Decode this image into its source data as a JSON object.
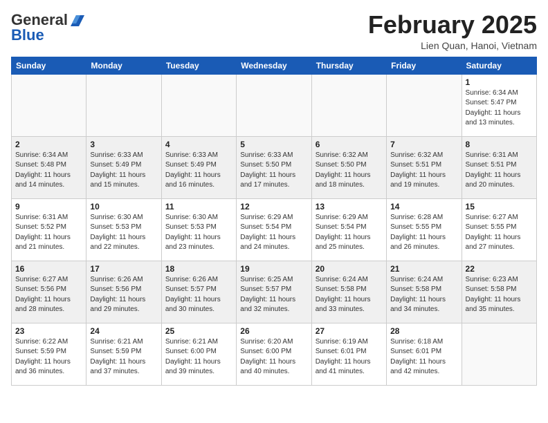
{
  "header": {
    "logo_line1": "General",
    "logo_line2": "Blue",
    "title": "February 2025",
    "subtitle": "Lien Quan, Hanoi, Vietnam"
  },
  "days_of_week": [
    "Sunday",
    "Monday",
    "Tuesday",
    "Wednesday",
    "Thursday",
    "Friday",
    "Saturday"
  ],
  "weeks": [
    {
      "shaded": false,
      "days": [
        {
          "num": "",
          "info": ""
        },
        {
          "num": "",
          "info": ""
        },
        {
          "num": "",
          "info": ""
        },
        {
          "num": "",
          "info": ""
        },
        {
          "num": "",
          "info": ""
        },
        {
          "num": "",
          "info": ""
        },
        {
          "num": "1",
          "info": "Sunrise: 6:34 AM\nSunset: 5:47 PM\nDaylight: 11 hours\nand 13 minutes."
        }
      ]
    },
    {
      "shaded": true,
      "days": [
        {
          "num": "2",
          "info": "Sunrise: 6:34 AM\nSunset: 5:48 PM\nDaylight: 11 hours\nand 14 minutes."
        },
        {
          "num": "3",
          "info": "Sunrise: 6:33 AM\nSunset: 5:49 PM\nDaylight: 11 hours\nand 15 minutes."
        },
        {
          "num": "4",
          "info": "Sunrise: 6:33 AM\nSunset: 5:49 PM\nDaylight: 11 hours\nand 16 minutes."
        },
        {
          "num": "5",
          "info": "Sunrise: 6:33 AM\nSunset: 5:50 PM\nDaylight: 11 hours\nand 17 minutes."
        },
        {
          "num": "6",
          "info": "Sunrise: 6:32 AM\nSunset: 5:50 PM\nDaylight: 11 hours\nand 18 minutes."
        },
        {
          "num": "7",
          "info": "Sunrise: 6:32 AM\nSunset: 5:51 PM\nDaylight: 11 hours\nand 19 minutes."
        },
        {
          "num": "8",
          "info": "Sunrise: 6:31 AM\nSunset: 5:51 PM\nDaylight: 11 hours\nand 20 minutes."
        }
      ]
    },
    {
      "shaded": false,
      "days": [
        {
          "num": "9",
          "info": "Sunrise: 6:31 AM\nSunset: 5:52 PM\nDaylight: 11 hours\nand 21 minutes."
        },
        {
          "num": "10",
          "info": "Sunrise: 6:30 AM\nSunset: 5:53 PM\nDaylight: 11 hours\nand 22 minutes."
        },
        {
          "num": "11",
          "info": "Sunrise: 6:30 AM\nSunset: 5:53 PM\nDaylight: 11 hours\nand 23 minutes."
        },
        {
          "num": "12",
          "info": "Sunrise: 6:29 AM\nSunset: 5:54 PM\nDaylight: 11 hours\nand 24 minutes."
        },
        {
          "num": "13",
          "info": "Sunrise: 6:29 AM\nSunset: 5:54 PM\nDaylight: 11 hours\nand 25 minutes."
        },
        {
          "num": "14",
          "info": "Sunrise: 6:28 AM\nSunset: 5:55 PM\nDaylight: 11 hours\nand 26 minutes."
        },
        {
          "num": "15",
          "info": "Sunrise: 6:27 AM\nSunset: 5:55 PM\nDaylight: 11 hours\nand 27 minutes."
        }
      ]
    },
    {
      "shaded": true,
      "days": [
        {
          "num": "16",
          "info": "Sunrise: 6:27 AM\nSunset: 5:56 PM\nDaylight: 11 hours\nand 28 minutes."
        },
        {
          "num": "17",
          "info": "Sunrise: 6:26 AM\nSunset: 5:56 PM\nDaylight: 11 hours\nand 29 minutes."
        },
        {
          "num": "18",
          "info": "Sunrise: 6:26 AM\nSunset: 5:57 PM\nDaylight: 11 hours\nand 30 minutes."
        },
        {
          "num": "19",
          "info": "Sunrise: 6:25 AM\nSunset: 5:57 PM\nDaylight: 11 hours\nand 32 minutes."
        },
        {
          "num": "20",
          "info": "Sunrise: 6:24 AM\nSunset: 5:58 PM\nDaylight: 11 hours\nand 33 minutes."
        },
        {
          "num": "21",
          "info": "Sunrise: 6:24 AM\nSunset: 5:58 PM\nDaylight: 11 hours\nand 34 minutes."
        },
        {
          "num": "22",
          "info": "Sunrise: 6:23 AM\nSunset: 5:58 PM\nDaylight: 11 hours\nand 35 minutes."
        }
      ]
    },
    {
      "shaded": false,
      "days": [
        {
          "num": "23",
          "info": "Sunrise: 6:22 AM\nSunset: 5:59 PM\nDaylight: 11 hours\nand 36 minutes."
        },
        {
          "num": "24",
          "info": "Sunrise: 6:21 AM\nSunset: 5:59 PM\nDaylight: 11 hours\nand 37 minutes."
        },
        {
          "num": "25",
          "info": "Sunrise: 6:21 AM\nSunset: 6:00 PM\nDaylight: 11 hours\nand 39 minutes."
        },
        {
          "num": "26",
          "info": "Sunrise: 6:20 AM\nSunset: 6:00 PM\nDaylight: 11 hours\nand 40 minutes."
        },
        {
          "num": "27",
          "info": "Sunrise: 6:19 AM\nSunset: 6:01 PM\nDaylight: 11 hours\nand 41 minutes."
        },
        {
          "num": "28",
          "info": "Sunrise: 6:18 AM\nSunset: 6:01 PM\nDaylight: 11 hours\nand 42 minutes."
        },
        {
          "num": "",
          "info": ""
        }
      ]
    }
  ]
}
